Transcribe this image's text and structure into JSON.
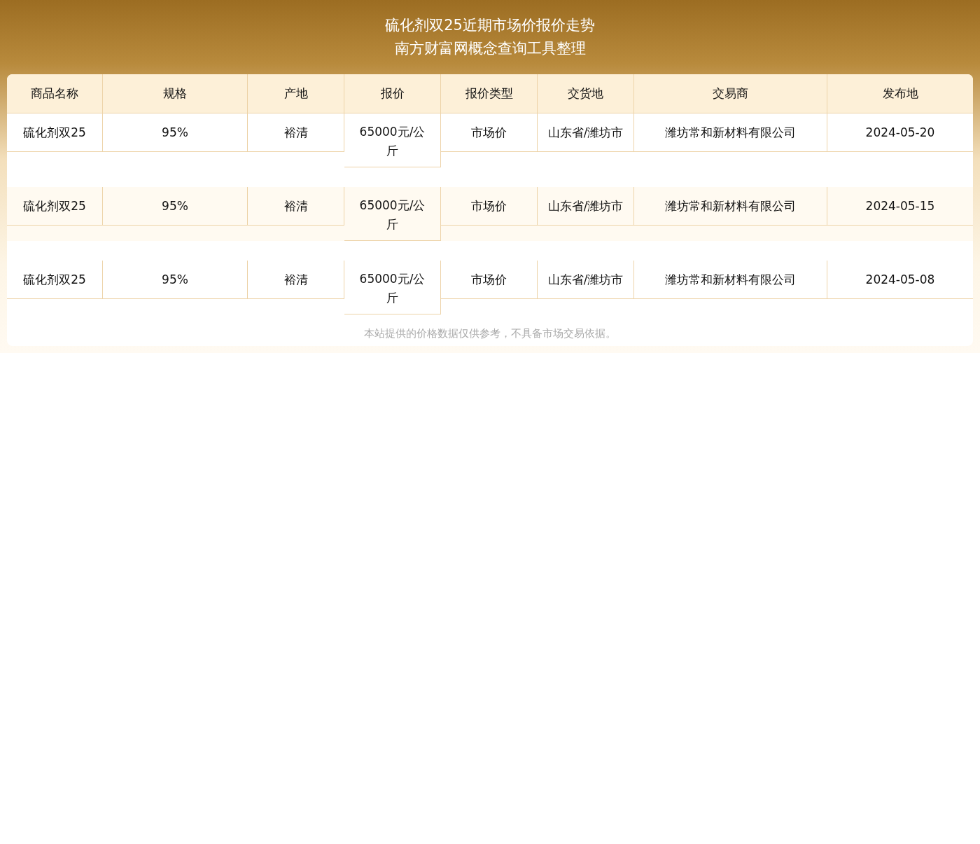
{
  "title": [
    "硫化剂双25近期市场价报价走势",
    "南方财富网概念查询工具整理"
  ],
  "table": {
    "columns": [
      "商品名称",
      "规格",
      "产地",
      "报价",
      "报价类型",
      "交货地",
      "交易商",
      "发布地"
    ],
    "rows": [
      {
        "cells": [
          "硫化剂双25",
          "95%",
          "裕清",
          "65000元/公斤",
          "市场价",
          "山东省/潍坊市",
          "潍坊常和新材料有限公司",
          "2024-05-20"
        ]
      },
      {
        "cells": [
          "硫化剂双25",
          "95%",
          "裕清",
          "65000元/公斤",
          "市场价",
          "山东省/潍坊市",
          "潍坊常和新材料有限公司",
          "2024-05-15"
        ]
      },
      {
        "cells": [
          "硫化剂双25",
          "95%",
          "裕清",
          "65000元/公斤",
          "市场价",
          "山东省/潍坊市",
          "潍坊常和新材料有限公司",
          "2024-05-08"
        ]
      }
    ]
  },
  "note": "本站提供的价格数据仅供参考，不具备市场交易依据。"
}
